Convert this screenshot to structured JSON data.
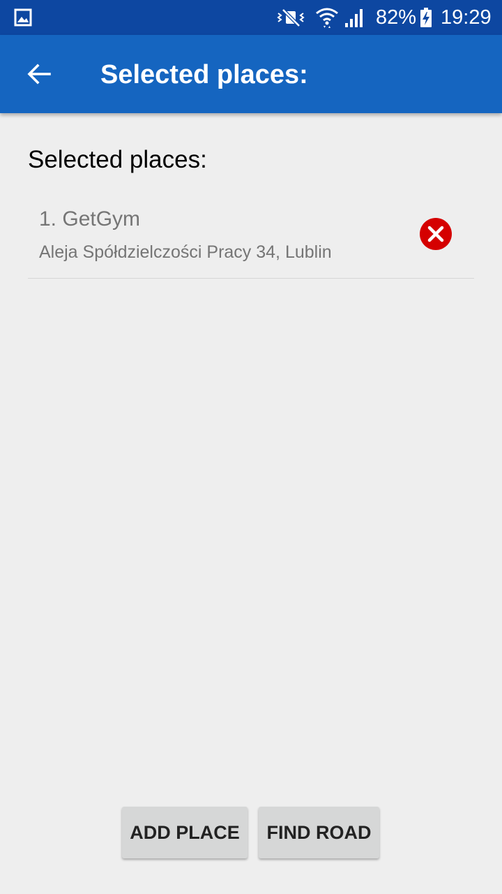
{
  "status_bar": {
    "battery_percent": "82%",
    "time": "19:29",
    "icons": [
      "gallery-icon",
      "mute-vibrate-icon",
      "wifi-icon",
      "cellular-signal-icon",
      "battery-charging-icon"
    ]
  },
  "app_bar": {
    "title": "Selected places:",
    "back_icon": "back-arrow-icon"
  },
  "content": {
    "heading": "Selected places:",
    "places": [
      {
        "name": "1. GetGym",
        "address": "Aleja Spółdzielczości Pracy 34, Lublin",
        "remove_icon": "remove-circle-icon"
      }
    ]
  },
  "actions": {
    "add_place_label": "ADD PLACE",
    "find_road_label": "FIND ROAD"
  },
  "colors": {
    "status_bar": "#0d47a1",
    "app_bar": "#1565c0",
    "background": "#eeeeee",
    "remove_red": "#d50000",
    "button_bg": "#d6d7d7"
  }
}
